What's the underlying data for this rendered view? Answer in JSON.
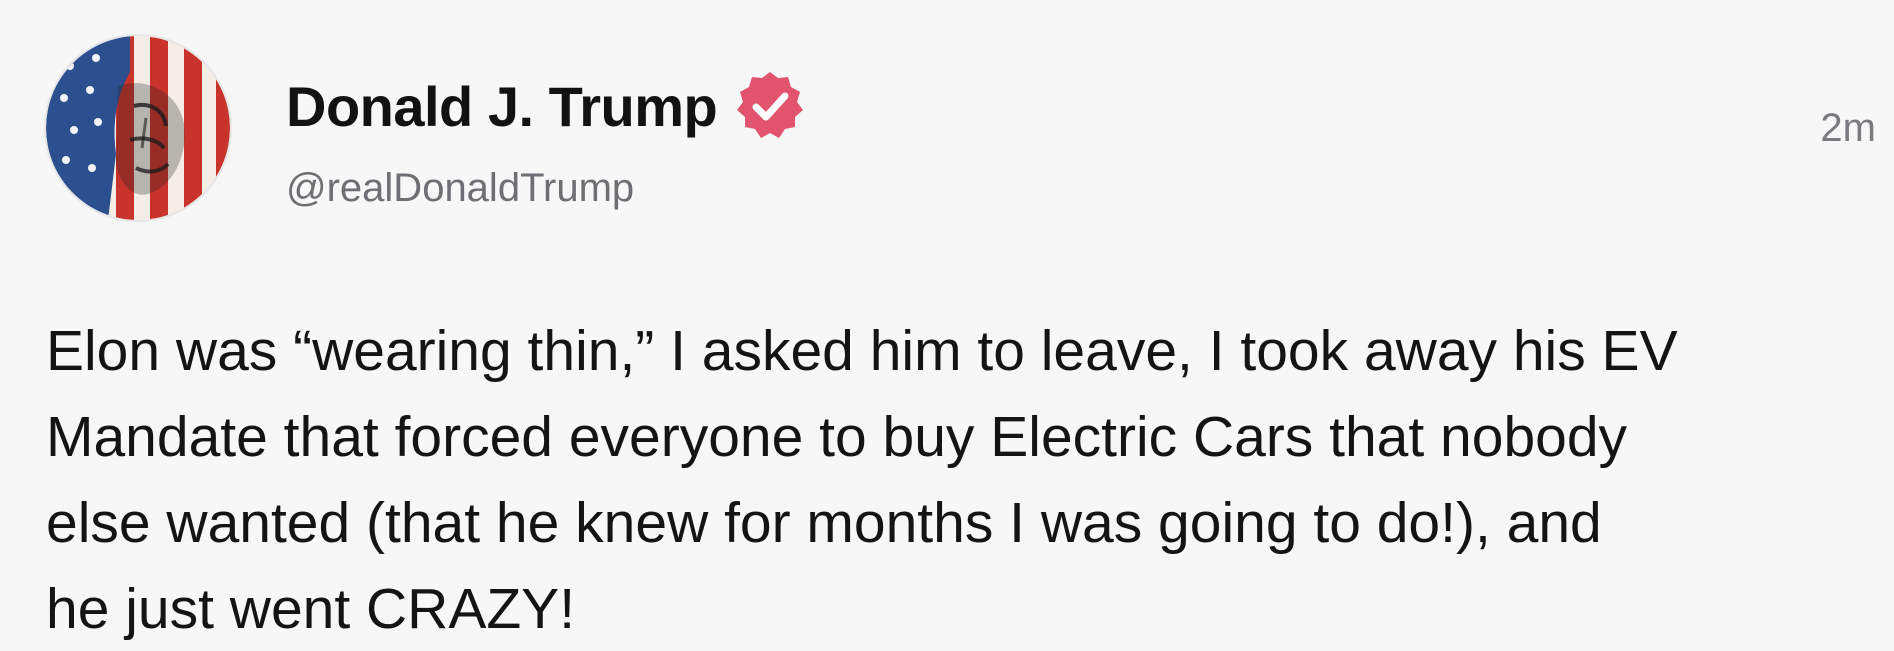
{
  "post": {
    "author": {
      "display_name": "Donald J. Trump",
      "handle": "@realDonaldTrump",
      "verified_icon": "verified-badge-icon",
      "avatar": "profile-avatar"
    },
    "timestamp": "2m",
    "body_lines": [
      "Elon was “wearing thin,” I asked him to leave, I took away his EV",
      "Mandate that forced everyone to buy Electric Cars that nobody",
      "else wanted (that he knew for months I was going to do!), and",
      "he just went CRAZY!"
    ]
  },
  "colors": {
    "background": "#f7f7f8",
    "text_primary": "#121212",
    "text_secondary": "#6e6e73",
    "verified_badge": "#e2536e"
  }
}
